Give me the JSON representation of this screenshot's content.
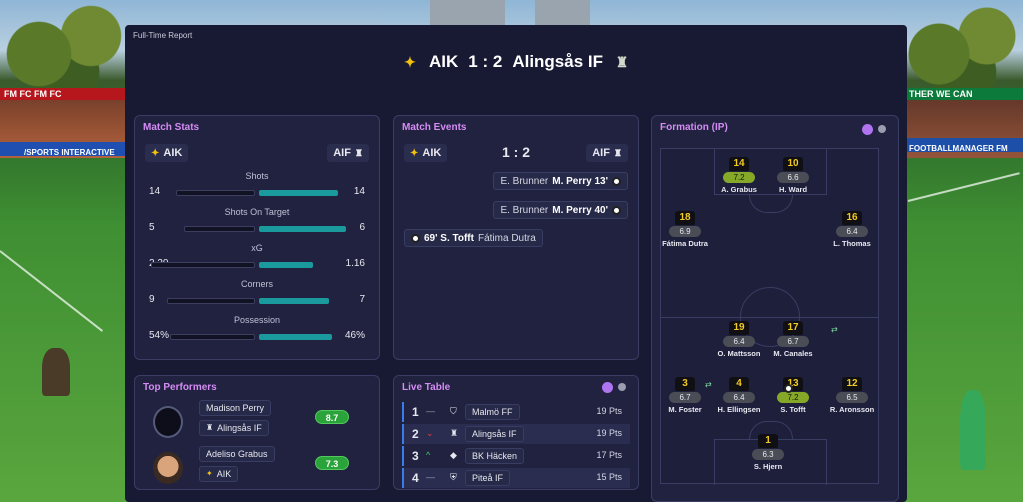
{
  "report_title": "Full-Time Report",
  "score": {
    "home": "AIK",
    "score": "1 : 2",
    "away": "Alingsås IF"
  },
  "match_stats": {
    "title": "Match Stats",
    "home": "AIK",
    "away": "AIF",
    "rows": [
      {
        "label": "Shots",
        "home": "14",
        "away": "14",
        "home_share": 0.5
      },
      {
        "label": "Shots On Target",
        "home": "5",
        "away": "6",
        "home_share": 0.45
      },
      {
        "label": "xG",
        "home": "2.30",
        "away": "1.16",
        "home_share": 0.66
      },
      {
        "label": "Corners",
        "home": "9",
        "away": "7",
        "home_share": 0.56
      },
      {
        "label": "Possession",
        "home": "54%",
        "away": "46%",
        "home_share": 0.54
      }
    ]
  },
  "match_events": {
    "title": "Match Events",
    "home": "AIK",
    "away": "AIF",
    "score": "1 : 2",
    "events": [
      {
        "assist": "E. Brunner",
        "scorer": "M. Perry 13'",
        "side": "away"
      },
      {
        "assist": "E. Brunner",
        "scorer": "M. Perry 40'",
        "side": "away"
      },
      {
        "scorer": "69' S. Tofft",
        "assist": "Fátima Dutra",
        "side": "home"
      }
    ]
  },
  "formation": {
    "title": "Formation (IP)",
    "players": [
      {
        "num": "14",
        "rating": "7.2",
        "good": true,
        "name": "A. Grabus"
      },
      {
        "num": "10",
        "rating": "6.6",
        "good": false,
        "name": "H. Ward"
      },
      {
        "num": "18",
        "rating": "6.9",
        "good": false,
        "name": "Fátima Dutra"
      },
      {
        "num": "16",
        "rating": "6.4",
        "good": false,
        "name": "L. Thomas"
      },
      {
        "num": "19",
        "rating": "6.4",
        "good": false,
        "name": "O. Mattsson"
      },
      {
        "num": "17",
        "rating": "6.7",
        "good": false,
        "name": "M. Canales"
      },
      {
        "num": "3",
        "rating": "6.7",
        "good": false,
        "name": "M. Foster"
      },
      {
        "num": "4",
        "rating": "6.4",
        "good": false,
        "name": "H. Ellingsen"
      },
      {
        "num": "13",
        "rating": "7.2",
        "good": true,
        "name": "S. Tofft"
      },
      {
        "num": "12",
        "rating": "6.5",
        "good": false,
        "name": "R. Aronsson"
      },
      {
        "num": "1",
        "rating": "6.3",
        "good": false,
        "name": "S. Hjern"
      }
    ]
  },
  "top_performers": {
    "title": "Top Performers",
    "players": [
      {
        "name": "Madison Perry",
        "team": "Alingsås IF",
        "rating": "8.7"
      },
      {
        "name": "Adeliso Grabus",
        "team": "AIK",
        "rating": "7.3"
      }
    ]
  },
  "live_table": {
    "title": "Live Table",
    "rows": [
      {
        "pos": "1",
        "move": "—",
        "team": "Malmö FF",
        "pts": "19 Pts"
      },
      {
        "pos": "2",
        "move": "⌄",
        "team": "Alingsås IF",
        "pts": "19 Pts"
      },
      {
        "pos": "3",
        "move": "^",
        "team": "BK Häcken",
        "pts": "17 Pts"
      },
      {
        "pos": "4",
        "move": "—",
        "team": "Piteå IF",
        "pts": "15 Pts"
      }
    ]
  },
  "background": {
    "ad_left": "FM FC  FM FC",
    "ad_right": "THER WE CAN",
    "board_left": "/SPORTS INTERACTIVE",
    "board_right": "FOOTBALLMANAGER   FM"
  },
  "colors": {
    "accent_title": "#d58cf5",
    "teal_bar": "#1a9a9c",
    "panel_bg": "#181a33"
  }
}
